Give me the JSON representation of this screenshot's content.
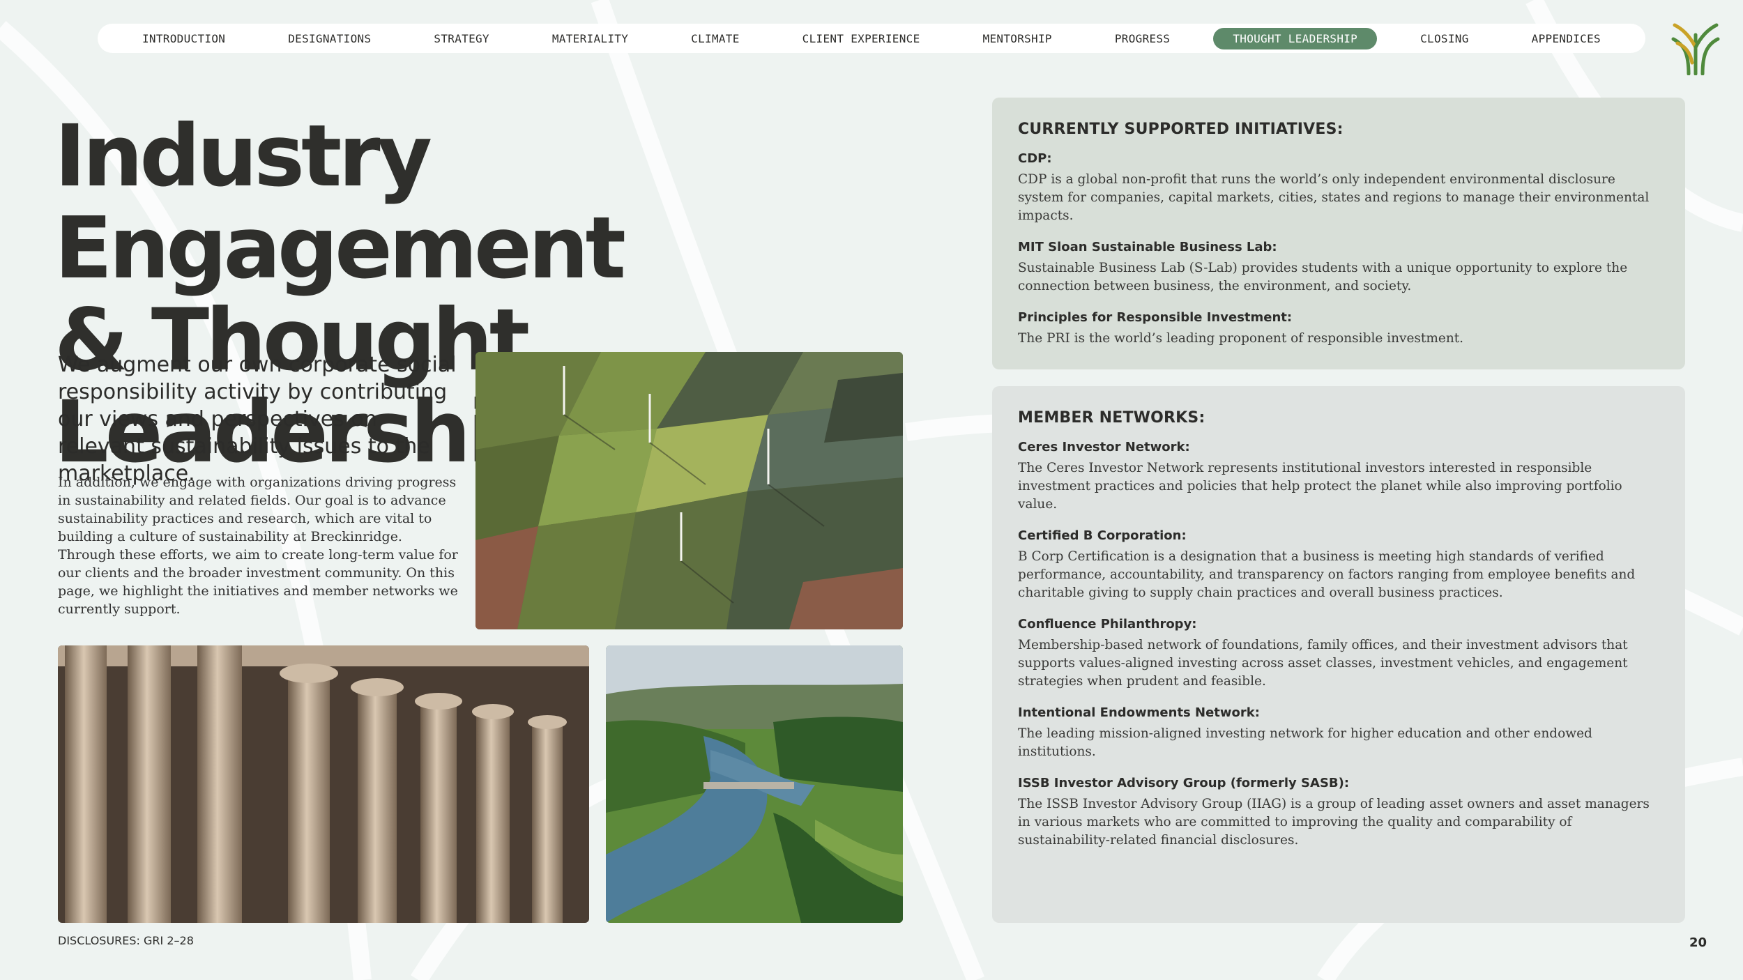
{
  "nav": {
    "items": [
      {
        "label": "INTRODUCTION"
      },
      {
        "label": "DESIGNATIONS"
      },
      {
        "label": "STRATEGY"
      },
      {
        "label": "MATERIALITY"
      },
      {
        "label": "CLIMATE"
      },
      {
        "label": "CLIENT EXPERIENCE"
      },
      {
        "label": "MENTORSHIP"
      },
      {
        "label": "PROGRESS"
      },
      {
        "label": "THOUGHT LEADERSHIP"
      },
      {
        "label": "CLOSING"
      },
      {
        "label": "APPENDICES"
      }
    ],
    "active": "THOUGHT LEADERSHIP"
  },
  "colors": {
    "background": "#eef3f1",
    "accent": "#5e8a6a",
    "panel_initiatives": "#d8dfd8",
    "panel_networks": "#dfe3e1",
    "logo_green": "#4f8a3c",
    "logo_gold": "#c9a227"
  },
  "logo_icon": "wheat-stalk-icon",
  "title": {
    "line1": "Industry Engagement",
    "line2": "& Thought Leadership"
  },
  "intro": {
    "lead": "We augment our own corporate social responsibility activity by contributing our views and perspectives on relevant sustainability issues to the marketplace.",
    "body": "In addition, we engage with organizations driving progress in sustainability and related fields. Our goal is to advance sustainability practices and research, which are vital to building a culture of sustainability at Breckinridge. Through these efforts, we aim to create long-term value for our clients and the broader investment community. On this page, we highlight the initiatives and member networks we currently support."
  },
  "images": [
    "aerial-farmland-wind-turbines",
    "classical-building-columns",
    "river-valley-bridge"
  ],
  "initiatives": {
    "heading": "CURRENTLY SUPPORTED INITIATIVES:",
    "items": [
      {
        "name": "CDP:",
        "desc": "CDP is a global non-profit that runs the world’s only independent environmental disclosure system for companies, capital markets, cities, states and regions to manage their environmental impacts."
      },
      {
        "name": "MIT Sloan Sustainable Business Lab:",
        "desc": "Sustainable Business Lab (S-Lab) provides students with a unique opportunity to explore the connection between business, the environment, and society."
      },
      {
        "name": "Principles for Responsible Investment:",
        "desc": "The PRI is the world’s leading proponent of responsible investment."
      }
    ]
  },
  "networks": {
    "heading": "MEMBER NETWORKS:",
    "items": [
      {
        "name": "Ceres Investor Network:",
        "desc": "The Ceres Investor Network represents institutional investors interested in responsible investment practices and policies that help protect the planet while also improving portfolio value."
      },
      {
        "name": "Certified B Corporation:",
        "desc": "B Corp Certification is a designation that a business is meeting high standards of verified performance, accountability, and transparency on factors ranging from employee benefits and charitable giving to supply chain practices and overall business practices."
      },
      {
        "name": "Confluence Philanthropy:",
        "desc": "Membership-based network of foundations, family offices, and their investment advisors that supports values-aligned investing across asset classes, investment vehicles, and engagement strategies when prudent and feasible."
      },
      {
        "name": "Intentional Endowments Network:",
        "desc": "The leading mission-aligned investing network for higher education and other endowed institutions."
      },
      {
        "name": "ISSB Investor Advisory Group (formerly SASB):",
        "desc": "The ISSB Investor Advisory Group (IIAG) is a group of leading asset owners and asset managers in various markets who are committed to improving the quality and comparability of sustainability-related financial disclosures."
      }
    ]
  },
  "footer": {
    "disclosures": "DISCLOSURES: GRI 2–28",
    "page_number": "20"
  }
}
